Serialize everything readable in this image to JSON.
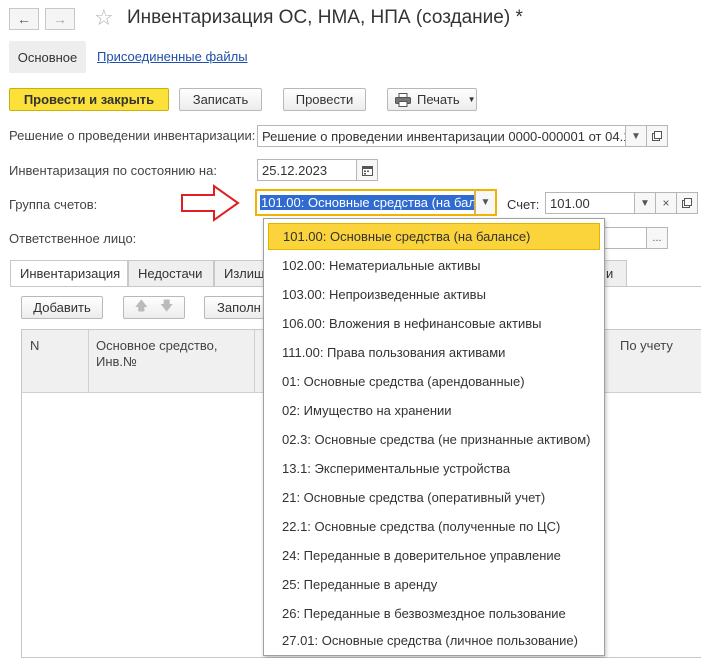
{
  "window": {
    "title": "Инвентаризация ОС, НМА, НПА (создание) *"
  },
  "nav_tabs": {
    "main": "Основное",
    "attached": "Присоединенные файлы"
  },
  "toolbar": {
    "post_close": "Провести и закрыть",
    "save": "Записать",
    "post": "Провести",
    "print": "Печать"
  },
  "form": {
    "decision_label": "Решение о проведении инвентаризации:",
    "decision_value": "Решение о проведении инвентаризации 0000-000001 от 04.1",
    "date_label": "Инвентаризация по состоянию на:",
    "date_value": "25.12.2023",
    "group_label": "Группа счетов:",
    "group_value": "101.00: Основные средства (на бала",
    "account_label": "Счет:",
    "account_value": "101.00",
    "responsible_label": "Ответственное лицо:"
  },
  "form_tabs": [
    "Инвентаризация",
    "Недостачи",
    "Излиш",
    "и"
  ],
  "table_toolbar": {
    "add": "Добавить",
    "fill": "Заполн"
  },
  "table": {
    "columns": [
      "N",
      "Основное средство,",
      "Инв.№",
      "По учету"
    ]
  },
  "dropdown": {
    "items": [
      "101.00: Основные средства (на балансе)",
      "102.00: Нематериальные активы",
      "103.00: Непроизведенные активы",
      "106.00: Вложения в нефинансовые активы",
      "111.00: Права пользования активами",
      "01: Основные средства (арендованные)",
      "02: Имущество на хранении",
      "02.3: Основные средства (не признанные активом)",
      "13.1: Экспериментальные устройства",
      "21: Основные средства (оперативный учет)",
      "22.1: Основные средства (полученные по ЦС)",
      "24: Переданные в доверительное управление",
      "25: Переданные в аренду",
      "26: Переданные в безвозмездное пользование",
      "27.01: Основные средства (личное пользование)"
    ],
    "highlighted_index": 0
  },
  "colors": {
    "accent_yellow": "#fbe13a",
    "highlight_yellow": "#fbd33a",
    "focus_border": "#f0b400",
    "annotation_arrow": "#e02020",
    "link_blue": "#1f4fa8",
    "selection_blue": "#2f6bd0"
  }
}
